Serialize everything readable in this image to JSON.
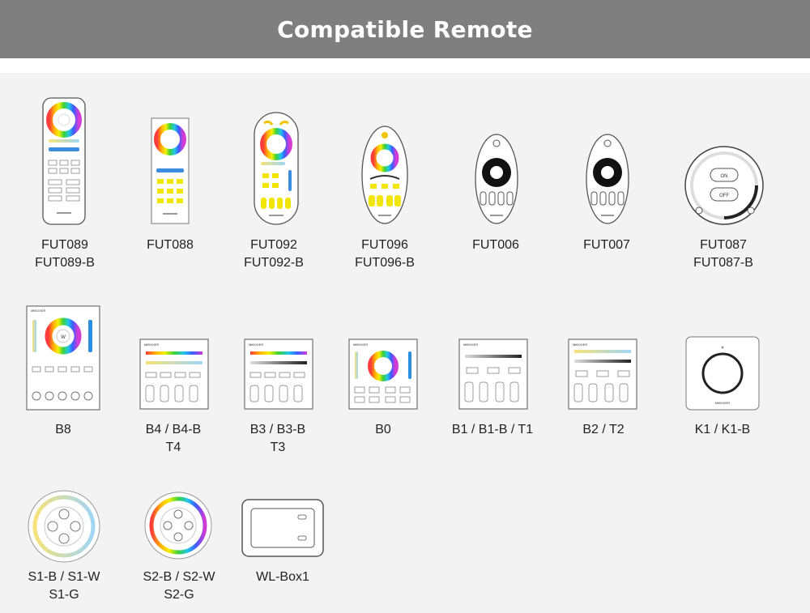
{
  "header": {
    "title": "Compatible Remote"
  },
  "remotes": [
    {
      "id": "fut089",
      "lines": [
        "FUT089",
        "FUT089-B"
      ]
    },
    {
      "id": "fut088",
      "lines": [
        "FUT088"
      ]
    },
    {
      "id": "fut092",
      "lines": [
        "FUT092",
        "FUT092-B"
      ]
    },
    {
      "id": "fut096",
      "lines": [
        "FUT096",
        "FUT096-B"
      ]
    },
    {
      "id": "fut006",
      "lines": [
        "FUT006"
      ]
    },
    {
      "id": "fut007",
      "lines": [
        "FUT007"
      ]
    },
    {
      "id": "fut087",
      "lines": [
        "FUT087",
        "FUT087-B"
      ]
    },
    {
      "id": "b8",
      "lines": [
        "B8"
      ]
    },
    {
      "id": "b4",
      "lines": [
        "B4 / B4-B",
        "T4"
      ]
    },
    {
      "id": "b3",
      "lines": [
        "B3 / B3-B",
        "T3"
      ]
    },
    {
      "id": "b0",
      "lines": [
        "B0"
      ]
    },
    {
      "id": "b1",
      "lines": [
        "B1 / B1-B / T1"
      ]
    },
    {
      "id": "b2",
      "lines": [
        "B2 / T2"
      ]
    },
    {
      "id": "k1",
      "lines": [
        "K1 / K1-B"
      ]
    },
    {
      "id": "s1",
      "lines": [
        "S1-B / S1-W",
        "S1-G"
      ]
    },
    {
      "id": "s2",
      "lines": [
        "S2-B / S2-W",
        "S2-G"
      ]
    },
    {
      "id": "wlbox1",
      "lines": [
        "WL-Box1"
      ]
    }
  ],
  "device_text": {
    "brand": "MiBOXER",
    "on": "ON",
    "off": "OFF",
    "w": "W"
  },
  "colors": {
    "header_bg": "#7f7f7f",
    "device_outline": "#555555",
    "device_body": "#ffffff",
    "accent_yellow": "#f2e600",
    "accent_blue": "#2b8fe0",
    "dial_dark": "#111111"
  }
}
